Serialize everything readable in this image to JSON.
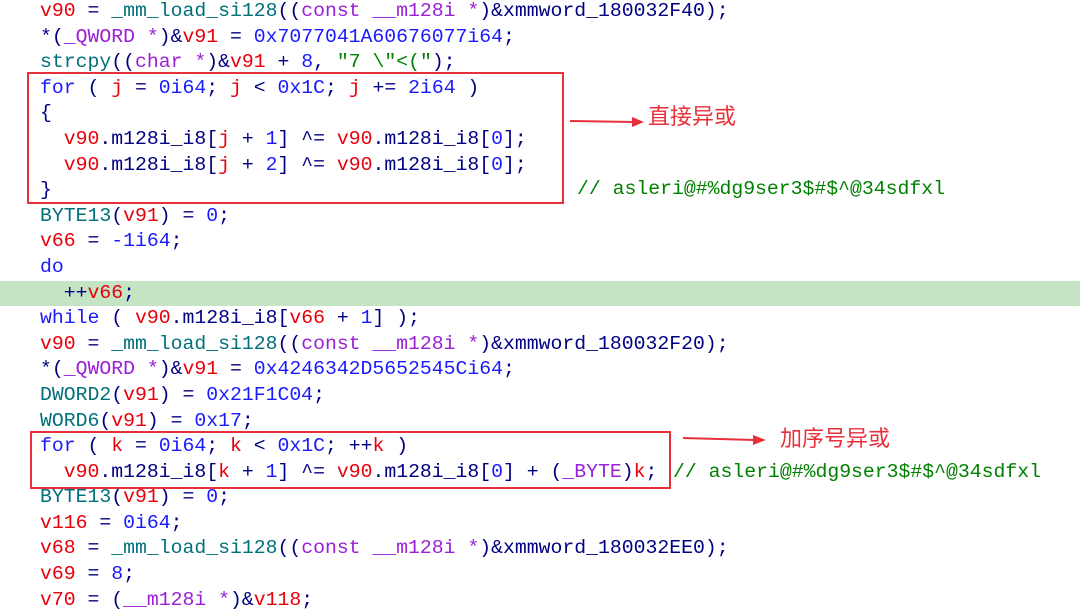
{
  "colors": {
    "variable": "#e8000b",
    "number": "#1a1aff",
    "punct": "#000080",
    "function": "#00707a",
    "type": "#9b1fd6",
    "string": "#008000",
    "annotation": "#e8303a",
    "highlight": "#c4e4c4"
  },
  "code": {
    "highlighted_line": 11,
    "lines": [
      [
        [
          "v90",
          "v"
        ],
        [
          " = ",
          "p"
        ],
        [
          "_mm_load_si128",
          "f"
        ],
        [
          "((",
          "p"
        ],
        [
          "const",
          "t"
        ],
        [
          " ",
          "p"
        ],
        [
          "__m128i *",
          "t"
        ],
        [
          ")&",
          "p"
        ],
        [
          "xmmword_180032F40",
          "p"
        ],
        [
          ");",
          "p"
        ]
      ],
      [
        [
          "*(",
          "p"
        ],
        [
          "_QWORD *",
          "t"
        ],
        [
          ")&",
          "p"
        ],
        [
          "v91",
          "v"
        ],
        [
          " = ",
          "p"
        ],
        [
          "0x7077041A60676077i64",
          "n"
        ],
        [
          ";",
          "p"
        ]
      ],
      [
        [
          "strcpy",
          "f"
        ],
        [
          "((",
          "p"
        ],
        [
          "char *",
          "t"
        ],
        [
          ")&",
          "p"
        ],
        [
          "v91",
          "v"
        ],
        [
          " + ",
          "p"
        ],
        [
          "8",
          "n"
        ],
        [
          ", ",
          "p"
        ],
        [
          "\"7 \\\"<(\"",
          "s"
        ],
        [
          ");",
          "p"
        ]
      ],
      [
        [
          "for",
          "n"
        ],
        [
          " ( ",
          "p"
        ],
        [
          "j",
          "v"
        ],
        [
          " = ",
          "p"
        ],
        [
          "0i64",
          "n"
        ],
        [
          "; ",
          "p"
        ],
        [
          "j",
          "v"
        ],
        [
          " < ",
          "p"
        ],
        [
          "0x1C",
          "n"
        ],
        [
          "; ",
          "p"
        ],
        [
          "j",
          "v"
        ],
        [
          " += ",
          "p"
        ],
        [
          "2i64",
          "n"
        ],
        [
          " )",
          "p"
        ]
      ],
      [
        [
          "{",
          "p"
        ]
      ],
      [
        [
          "  ",
          "p"
        ],
        [
          "v90",
          "v"
        ],
        [
          ".m128i_i8[",
          "p"
        ],
        [
          "j",
          "v"
        ],
        [
          " + ",
          "p"
        ],
        [
          "1",
          "n"
        ],
        [
          "] ^= ",
          "p"
        ],
        [
          "v90",
          "v"
        ],
        [
          ".m128i_i8[",
          "p"
        ],
        [
          "0",
          "n"
        ],
        [
          "];",
          "p"
        ]
      ],
      [
        [
          "  ",
          "p"
        ],
        [
          "v90",
          "v"
        ],
        [
          ".m128i_i8[",
          "p"
        ],
        [
          "j",
          "v"
        ],
        [
          " + ",
          "p"
        ],
        [
          "2",
          "n"
        ],
        [
          "] ^= ",
          "p"
        ],
        [
          "v90",
          "v"
        ],
        [
          ".m128i_i8[",
          "p"
        ],
        [
          "0",
          "n"
        ],
        [
          "];",
          "p"
        ]
      ],
      [
        [
          "}",
          "p"
        ]
      ],
      [
        [
          "BYTE13",
          "f"
        ],
        [
          "(",
          "p"
        ],
        [
          "v91",
          "v"
        ],
        [
          ") = ",
          "p"
        ],
        [
          "0",
          "n"
        ],
        [
          ";",
          "p"
        ]
      ],
      [
        [
          "v66",
          "v"
        ],
        [
          " = ",
          "p"
        ],
        [
          "-1i64",
          "n"
        ],
        [
          ";",
          "p"
        ]
      ],
      [
        [
          "do",
          "n"
        ]
      ],
      [
        [
          "  ++",
          "p"
        ],
        [
          "v66",
          "v"
        ],
        [
          ";",
          "p"
        ]
      ],
      [
        [
          "while",
          "n"
        ],
        [
          " ( ",
          "p"
        ],
        [
          "v90",
          "v"
        ],
        [
          ".m128i_i8[",
          "p"
        ],
        [
          "v66",
          "v"
        ],
        [
          " + ",
          "p"
        ],
        [
          "1",
          "n"
        ],
        [
          "] );",
          "p"
        ]
      ],
      [
        [
          "v90",
          "v"
        ],
        [
          " = ",
          "p"
        ],
        [
          "_mm_load_si128",
          "f"
        ],
        [
          "((",
          "p"
        ],
        [
          "const",
          "t"
        ],
        [
          " ",
          "p"
        ],
        [
          "__m128i *",
          "t"
        ],
        [
          ")&",
          "p"
        ],
        [
          "xmmword_180032F20",
          "p"
        ],
        [
          ");",
          "p"
        ]
      ],
      [
        [
          "*(",
          "p"
        ],
        [
          "_QWORD *",
          "t"
        ],
        [
          ")&",
          "p"
        ],
        [
          "v91",
          "v"
        ],
        [
          " = ",
          "p"
        ],
        [
          "0x4246342D5652545Ci64",
          "n"
        ],
        [
          ";",
          "p"
        ]
      ],
      [
        [
          "DWORD2",
          "f"
        ],
        [
          "(",
          "p"
        ],
        [
          "v91",
          "v"
        ],
        [
          ") = ",
          "p"
        ],
        [
          "0x21F1C04",
          "n"
        ],
        [
          ";",
          "p"
        ]
      ],
      [
        [
          "WORD6",
          "f"
        ],
        [
          "(",
          "p"
        ],
        [
          "v91",
          "v"
        ],
        [
          ") = ",
          "p"
        ],
        [
          "0x17",
          "n"
        ],
        [
          ";",
          "p"
        ]
      ],
      [
        [
          "for",
          "n"
        ],
        [
          " ( ",
          "p"
        ],
        [
          "k",
          "v"
        ],
        [
          " = ",
          "p"
        ],
        [
          "0i64",
          "n"
        ],
        [
          "; ",
          "p"
        ],
        [
          "k",
          "v"
        ],
        [
          " < ",
          "p"
        ],
        [
          "0x1C",
          "n"
        ],
        [
          "; ++",
          "p"
        ],
        [
          "k",
          "v"
        ],
        [
          " )",
          "p"
        ]
      ],
      [
        [
          "  ",
          "p"
        ],
        [
          "v90",
          "v"
        ],
        [
          ".m128i_i8[",
          "p"
        ],
        [
          "k",
          "v"
        ],
        [
          " + ",
          "p"
        ],
        [
          "1",
          "n"
        ],
        [
          "] ^= ",
          "p"
        ],
        [
          "v90",
          "v"
        ],
        [
          ".m128i_i8[",
          "p"
        ],
        [
          "0",
          "n"
        ],
        [
          "] + (",
          "p"
        ],
        [
          "_BYTE",
          "t"
        ],
        [
          ")",
          "p"
        ],
        [
          "k",
          "v"
        ],
        [
          ";",
          "p"
        ]
      ],
      [
        [
          "BYTE13",
          "f"
        ],
        [
          "(",
          "p"
        ],
        [
          "v91",
          "v"
        ],
        [
          ") = ",
          "p"
        ],
        [
          "0",
          "n"
        ],
        [
          ";",
          "p"
        ]
      ],
      [
        [
          "v116",
          "v"
        ],
        [
          " = ",
          "p"
        ],
        [
          "0i64",
          "n"
        ],
        [
          ";",
          "p"
        ]
      ],
      [
        [
          "v68",
          "v"
        ],
        [
          " = ",
          "p"
        ],
        [
          "_mm_load_si128",
          "f"
        ],
        [
          "((",
          "p"
        ],
        [
          "const",
          "t"
        ],
        [
          " ",
          "p"
        ],
        [
          "__m128i *",
          "t"
        ],
        [
          ")&",
          "p"
        ],
        [
          "xmmword_180032EE0",
          "p"
        ],
        [
          ");",
          "p"
        ]
      ],
      [
        [
          "v69",
          "v"
        ],
        [
          " = ",
          "p"
        ],
        [
          "8",
          "n"
        ],
        [
          ";",
          "p"
        ]
      ],
      [
        [
          "v70",
          "v"
        ],
        [
          " = (",
          "p"
        ],
        [
          "__m128i *",
          "t"
        ],
        [
          ")&",
          "p"
        ],
        [
          "v118",
          "v"
        ],
        [
          ";",
          "p"
        ]
      ]
    ],
    "comments": [
      "// asleri@#%dg9ser3$#$^@34sdfxl",
      "// asleri@#%dg9ser3$#$^@34sdfxl"
    ]
  },
  "annotations": {
    "box1_label": "直接异或",
    "box2_label": "加序号异或"
  }
}
